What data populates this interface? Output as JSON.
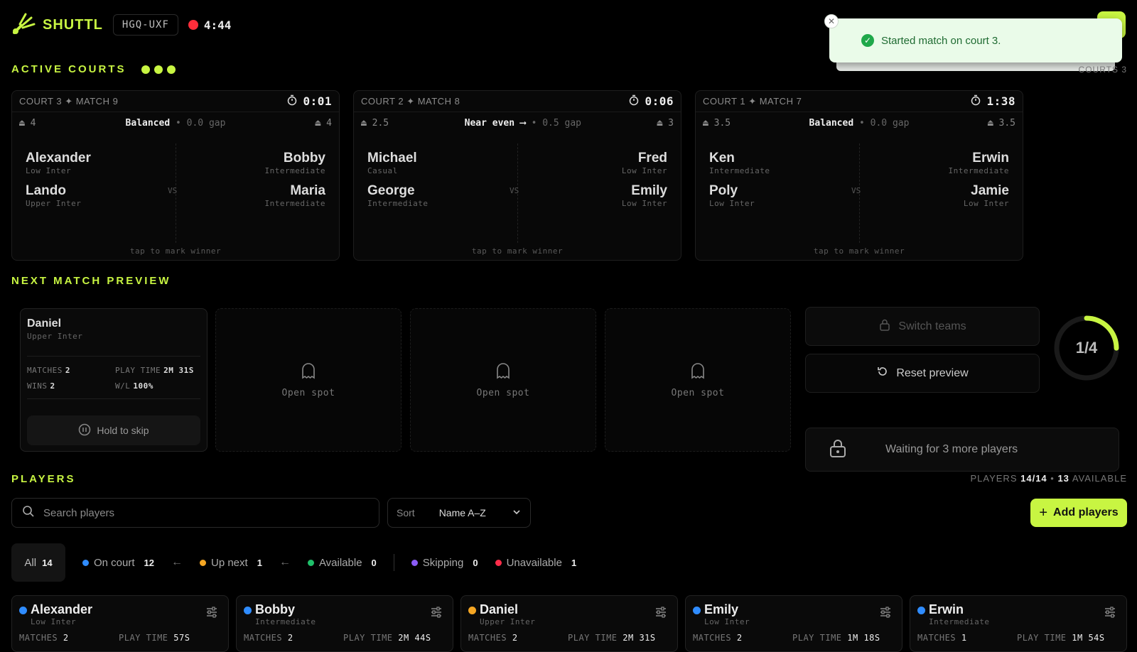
{
  "header": {
    "brand": "SHUTTL",
    "session_code": "HGQ-UXF",
    "timer": "4:44"
  },
  "toast": {
    "message": "Started match on court 3."
  },
  "active_courts": {
    "title": "ACTIVE COURTS",
    "count_label": "COURTS 3",
    "courts": [
      {
        "label": "COURT 3 ✦ MATCH 9",
        "timer": "0:01",
        "left_rating": "4",
        "status": "Balanced",
        "gap": "• 0.0 gap",
        "right_rating": "4",
        "left": [
          {
            "name": "Alexander",
            "level": "Low Inter"
          },
          {
            "name": "Lando",
            "level": "Upper Inter"
          }
        ],
        "right": [
          {
            "name": "Bobby",
            "level": "Intermediate"
          },
          {
            "name": "Maria",
            "level": "Intermediate"
          }
        ],
        "vs": "VS",
        "tap": "tap to mark winner"
      },
      {
        "label": "COURT 2 ✦ MATCH 8",
        "timer": "0:06",
        "left_rating": "2.5",
        "status": "Near even ⟶",
        "gap": "• 0.5 gap",
        "right_rating": "3",
        "left": [
          {
            "name": "Michael",
            "level": "Casual"
          },
          {
            "name": "George",
            "level": "Intermediate"
          }
        ],
        "right": [
          {
            "name": "Fred",
            "level": "Low Inter"
          },
          {
            "name": "Emily",
            "level": "Low Inter"
          }
        ],
        "vs": "VS",
        "tap": "tap to mark winner"
      },
      {
        "label": "COURT 1 ✦ MATCH 7",
        "timer": "1:38",
        "left_rating": "3.5",
        "status": "Balanced",
        "gap": "• 0.0 gap",
        "right_rating": "3.5",
        "left": [
          {
            "name": "Ken",
            "level": "Intermediate"
          },
          {
            "name": "Poly",
            "level": "Low Inter"
          }
        ],
        "right": [
          {
            "name": "Erwin",
            "level": "Intermediate"
          },
          {
            "name": "Jamie",
            "level": "Low Inter"
          }
        ],
        "vs": "VS",
        "tap": "tap to mark winner"
      }
    ]
  },
  "next_match": {
    "title": "NEXT MATCH PREVIEW",
    "player": {
      "name": "Daniel",
      "level": "Upper Inter",
      "matches_label": "MATCHES",
      "matches": "2",
      "play_time_label": "PLAY TIME",
      "play_time": "2M 31S",
      "wins_label": "WINS",
      "wins": "2",
      "wl_label": "W/L",
      "wl": "100%"
    },
    "hold_label": "Hold to skip",
    "open_spot": "Open spot",
    "switch_label": "Switch teams",
    "reset_label": "Reset preview",
    "progress_label": "1/4",
    "progress_fraction": 0.25,
    "waiting_label": "Waiting for 3 more players"
  },
  "players": {
    "title": "PLAYERS",
    "summary_prefix": "PLAYERS",
    "summary_count": "14/14",
    "summary_available": "13",
    "summary_suffix": "AVAILABLE",
    "search_placeholder": "Search players",
    "sort_label": "Sort",
    "sort_value": "Name A–Z",
    "add_label": "Add players",
    "filters": {
      "all": {
        "label": "All",
        "count": "14"
      },
      "on_court": {
        "label": "On court",
        "count": "12",
        "color": "#2f8cff"
      },
      "up_next": {
        "label": "Up next",
        "count": "1",
        "color": "#f5a623"
      },
      "available": {
        "label": "Available",
        "count": "0",
        "color": "#1fbf6a"
      },
      "skipping": {
        "label": "Skipping",
        "count": "0",
        "color": "#8b5cf6"
      },
      "unavailable": {
        "label": "Unavailable",
        "count": "1",
        "color": "#ff2d4a"
      }
    },
    "cards": [
      {
        "name": "Alexander",
        "level": "Low Inter",
        "matches": "2",
        "play_time": "57S",
        "dot": "#2f8cff"
      },
      {
        "name": "Bobby",
        "level": "Intermediate",
        "matches": "2",
        "play_time": "2M 44S",
        "dot": "#2f8cff"
      },
      {
        "name": "Daniel",
        "level": "Upper Inter",
        "matches": "2",
        "play_time": "2M 31S",
        "dot": "#f5a623"
      },
      {
        "name": "Emily",
        "level": "Low Inter",
        "matches": "2",
        "play_time": "1M 18S",
        "dot": "#2f8cff"
      },
      {
        "name": "Erwin",
        "level": "Intermediate",
        "matches": "1",
        "play_time": "1M 54S",
        "dot": "#2f8cff"
      }
    ],
    "matches_label": "MATCHES",
    "play_time_label": "PLAY TIME"
  }
}
